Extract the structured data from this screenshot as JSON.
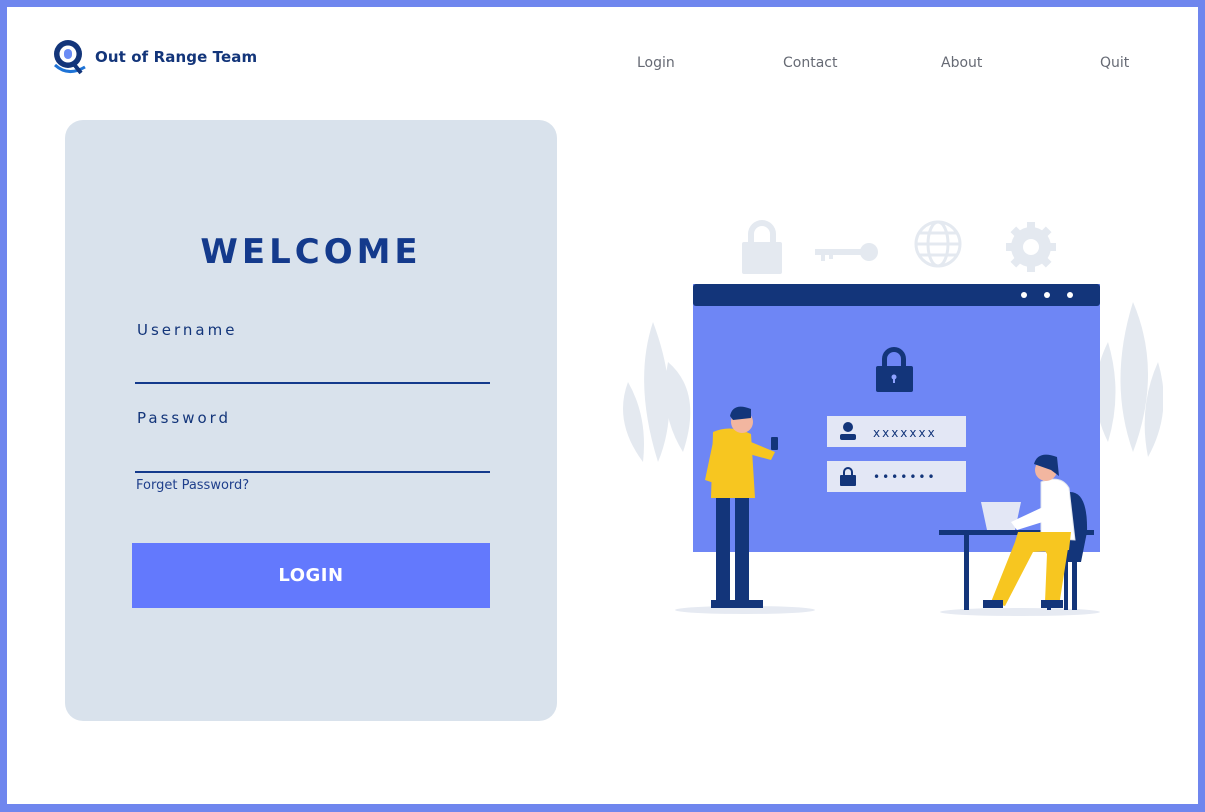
{
  "brand": {
    "title": "Out of Range Team",
    "logo_icon": "q-logo-icon",
    "color": "#13357a"
  },
  "nav": [
    {
      "label": "Login"
    },
    {
      "label": "Contact"
    },
    {
      "label": "About"
    },
    {
      "label": "Quit"
    }
  ],
  "login_card": {
    "heading": "WELCOME",
    "username_label": "Username",
    "username_value": "",
    "password_label": "Password",
    "password_value": "",
    "forget_label": "Forget Password?",
    "submit_label": "LOGIN"
  },
  "illustration": {
    "username_mask": "xxxxxxx",
    "password_mask": "•••••••"
  },
  "colors": {
    "frame": "#6f86ee",
    "card_bg": "#d9e2ec",
    "primary": "#143a8c",
    "button": "#6379fd",
    "accent_yellow": "#f7c620"
  }
}
